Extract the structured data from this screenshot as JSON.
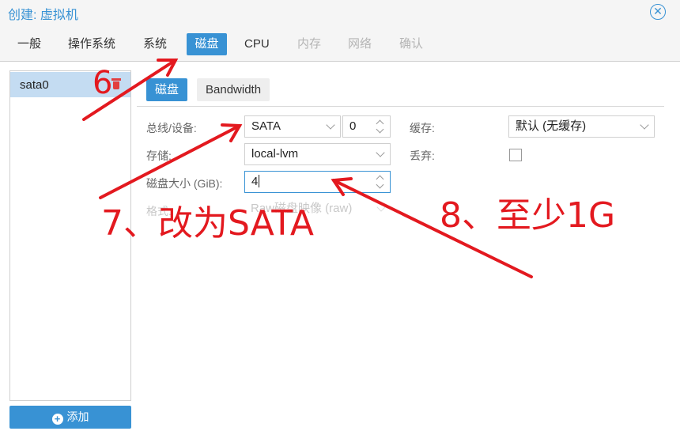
{
  "window": {
    "title": "创建: 虚拟机"
  },
  "tabs": [
    {
      "label": "一般"
    },
    {
      "label": "操作系统"
    },
    {
      "label": "系统"
    },
    {
      "label": "磁盘"
    },
    {
      "label": "CPU"
    },
    {
      "label": "内存"
    },
    {
      "label": "网络"
    },
    {
      "label": "确认"
    }
  ],
  "active_tab": "磁盘",
  "disks": [
    {
      "label": "sata0"
    }
  ],
  "add_button": {
    "label": "添加"
  },
  "subtabs": [
    {
      "label": "磁盘"
    },
    {
      "label": "Bandwidth"
    }
  ],
  "form": {
    "bus_label": "总线/设备:",
    "bus_value": "SATA",
    "device_index": "0",
    "storage_label": "存储:",
    "storage_value": "local-lvm",
    "size_label": "磁盘大小 (GiB):",
    "size_value": "4",
    "format_label": "格式:",
    "format_value": "Raw磁盘映像 (raw)",
    "cache_label": "缓存:",
    "cache_value": "默认 (无缓存)",
    "discard_label": "丢弃:"
  },
  "annotations": {
    "step6": "6",
    "step7": "7、改为SATA",
    "step8": "8、至少1G"
  },
  "colors": {
    "accent": "#3892d4",
    "selected_row": "#c4dcf2",
    "annotation": "#e3191f",
    "delete": "#e23e3e"
  }
}
